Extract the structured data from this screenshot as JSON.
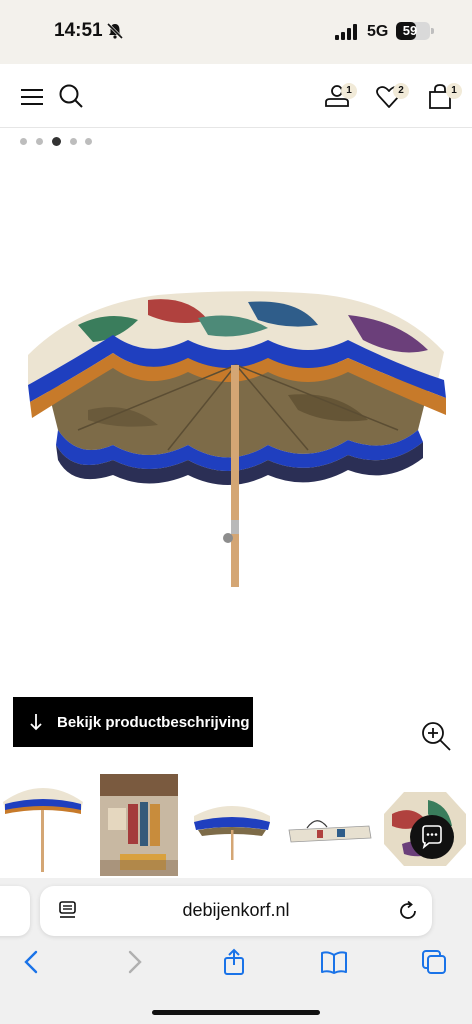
{
  "status_bar": {
    "time": "14:51",
    "network": "5G",
    "battery_level": "59",
    "battery_fraction": 0.59
  },
  "header": {
    "icons": [
      "menu-icon",
      "search-icon",
      "account-icon",
      "heart-icon",
      "bag-icon"
    ],
    "account_badge": "1",
    "wishlist_badge": "2",
    "bag_badge": "1",
    "badge_color": "#f1ead8"
  },
  "gallery": {
    "dots_total": 5,
    "active_dot": 3
  },
  "product": {
    "description_button_label": "Bekijk productbeschrijving"
  },
  "browser": {
    "url": "debijenkorf.nl",
    "accent": "#1a73e8"
  },
  "colors": {
    "fringe_blue": "#1f3fbf",
    "fringe_orange": "#c77a2a",
    "pole": "#d4a674",
    "canopy_inner": "#7d6b48"
  }
}
